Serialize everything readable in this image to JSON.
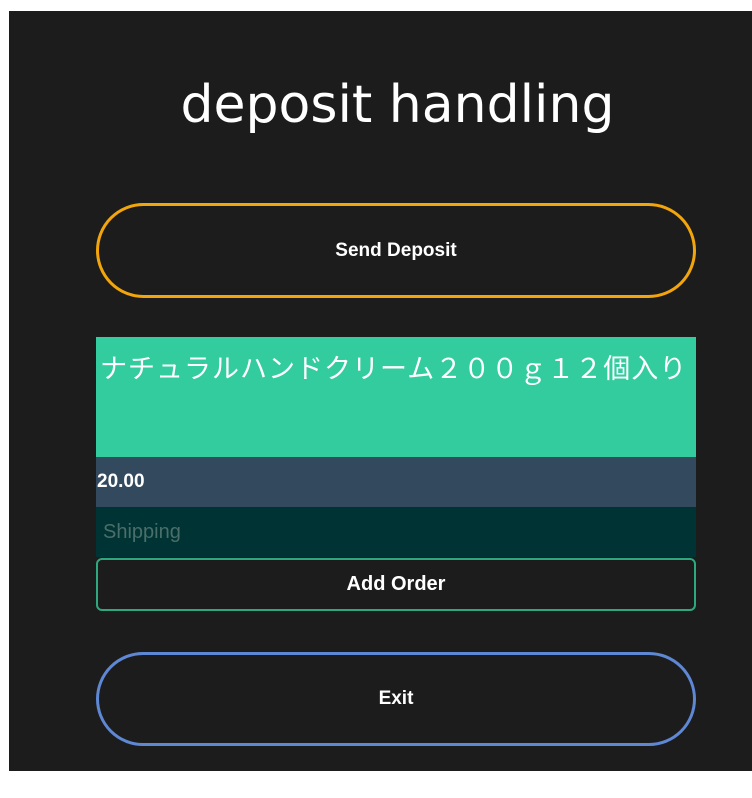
{
  "title": "deposit handling",
  "buttons": {
    "send_deposit": "Send Deposit",
    "add_order": "Add Order",
    "exit": "Exit"
  },
  "product": {
    "name": "ナチュラルハンドクリーム２００ｇ１２個入り",
    "price": "20.00"
  },
  "shipping": {
    "value": "",
    "placeholder": "Shipping"
  },
  "colors": {
    "background": "#1c1c1c",
    "send_border": "#f2a60c",
    "exit_border": "#5e87d4",
    "product_bg": "#33cc9e",
    "price_bg": "#334a5e",
    "shipping_bg": "#003333",
    "add_border": "#2ea87f"
  }
}
